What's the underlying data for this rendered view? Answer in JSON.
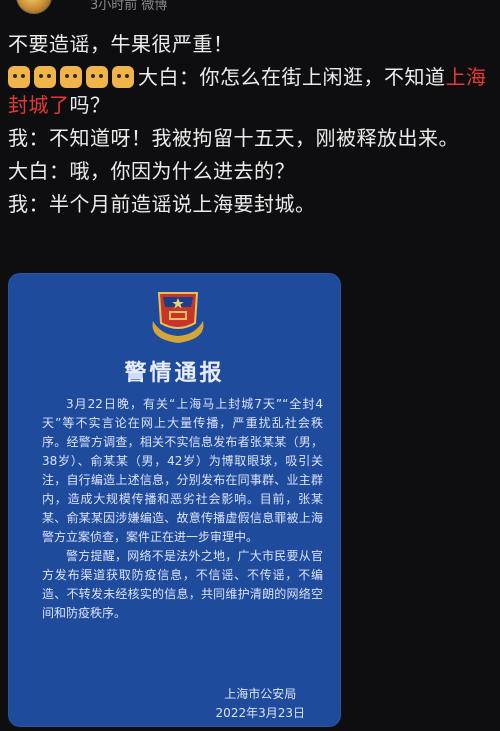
{
  "header": {
    "meta": "3小时前 微博"
  },
  "post": {
    "line1": "不要造谣，牛果很严重！",
    "line2_before": "大白：你怎么在街上闲逛，不知道",
    "line2_highlight": "上海封城了",
    "line2_after": "吗？",
    "line3": "我：不知道呀！我被拘留十五天，刚被释放出来。",
    "line4": "大白：哦，你因为什么进去的？",
    "line5": "我：半个月前造谣说上海要封城。"
  },
  "notice": {
    "title": "警情通报",
    "para1": "3月22日晚，有关“上海马上封城7天”“全封4天”等不实言论在网上大量传播，严重扰乱社会秩序。经警方调查，相关不实信息发布者张某某（男，38岁）、俞某某（男，42岁）为博取眼球，吸引关注，自行编造上述信息，分别发布在同事群、业主群内，造成大规模传播和恶劣社会影响。目前，张某某、俞某某因涉嫌编造、故意传播虚假信息罪被上海警方立案侦查，案件正在进一步审理中。",
    "para2": "警方提醒，网络不是法外之地，广大市民要从官方发布渠道获取防疫信息，不信谣、不传谣，不编造、不转发未经核实的信息，共同维护清朗的网络空间和防疫秩序。",
    "issuer": "上海市公安局",
    "date": "2022年3月23日"
  }
}
